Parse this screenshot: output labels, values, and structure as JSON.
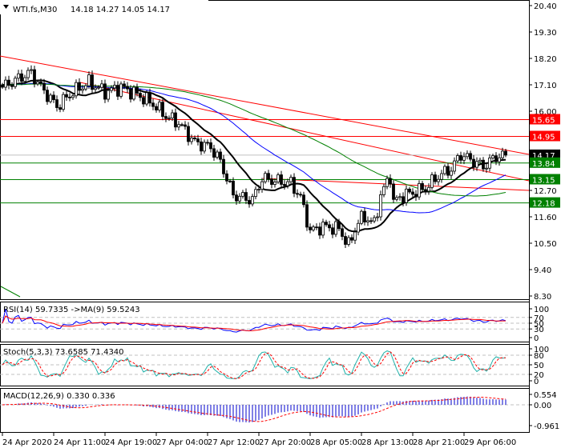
{
  "header": {
    "symbol": "WTI.fs,M30",
    "ohlc": "14.18 14.27 14.05 14.17"
  },
  "chart_data": {
    "type": "candlestick",
    "title": "WTI.fs,M30",
    "timeframe": "M30",
    "last": {
      "open": 14.18,
      "high": 14.27,
      "low": 14.05,
      "close": 14.17
    },
    "ylim": [
      8.3,
      20.4
    ],
    "price_ticks": [
      "20.40",
      "19.30",
      "18.20",
      "17.10",
      "16.00",
      "12.70",
      "11.60",
      "10.50",
      "9.40",
      "8.30"
    ],
    "x_ticks": [
      "24 Apr 2020",
      "24 Apr 11:00",
      "24 Apr 19:00",
      "27 Apr 04:00",
      "27 Apr 12:00",
      "27 Apr 20:00",
      "28 Apr 05:00",
      "28 Apr 13:00",
      "28 Apr 21:00",
      "29 Apr 06:00"
    ],
    "bars": 158,
    "close_keypoints": [
      [
        0,
        17.0
      ],
      [
        7,
        17.5
      ],
      [
        9,
        17.6
      ],
      [
        12,
        17.0
      ],
      [
        17,
        16.2
      ],
      [
        22,
        16.8
      ],
      [
        27,
        17.2
      ],
      [
        32,
        16.8
      ],
      [
        37,
        17.0
      ],
      [
        42,
        16.7
      ],
      [
        47,
        16.3
      ],
      [
        51,
        15.8
      ],
      [
        55,
        15.5
      ],
      [
        60,
        14.7
      ],
      [
        65,
        14.5
      ],
      [
        68,
        13.9
      ],
      [
        72,
        12.5
      ],
      [
        75,
        12.4
      ],
      [
        78,
        12.3
      ],
      [
        81,
        13.2
      ],
      [
        85,
        13.1
      ],
      [
        90,
        13.0
      ],
      [
        93,
        12.4
      ],
      [
        96,
        11.0
      ],
      [
        100,
        11.2
      ],
      [
        105,
        11.1
      ],
      [
        108,
        10.4
      ],
      [
        111,
        11.4
      ],
      [
        113,
        11.6
      ],
      [
        116,
        11.3
      ],
      [
        118,
        12.5
      ],
      [
        121,
        13.3
      ],
      [
        122,
        12.2
      ],
      [
        125,
        12.5
      ],
      [
        128,
        12.6
      ],
      [
        132,
        12.8
      ],
      [
        136,
        13.3
      ],
      [
        140,
        13.6
      ],
      [
        143,
        14.2
      ],
      [
        147,
        13.9
      ],
      [
        150,
        13.7
      ],
      [
        154,
        14.1
      ],
      [
        157,
        14.17
      ]
    ],
    "levels": [
      {
        "price": 15.65,
        "label": "15.65",
        "color": "#ff0000"
      },
      {
        "price": 14.95,
        "label": "14.95",
        "color": "#ff0000"
      },
      {
        "price": 14.17,
        "label": "14.17",
        "color": "#000000"
      },
      {
        "price": 13.84,
        "label": "13.84",
        "color": "#008000"
      },
      {
        "price": 13.15,
        "label": "13.15",
        "color": "#008000"
      },
      {
        "price": 12.18,
        "label": "12.18",
        "color": "#008000"
      }
    ],
    "trendlines": [
      {
        "from": [
          0,
          18.3
        ],
        "to": [
          157,
          14.2
        ],
        "color": "#ff0000"
      },
      {
        "from": [
          25,
          17.2
        ],
        "to": [
          157,
          13.1
        ],
        "color": "#ff0000"
      },
      {
        "from": [
          82,
          13.2
        ],
        "to": [
          157,
          12.7
        ],
        "color": "#ff0000"
      }
    ],
    "moving_averages": [
      {
        "period": 14,
        "color": "#000000"
      },
      {
        "period": 40,
        "color": "#0000ff"
      },
      {
        "period": 80,
        "color": "#008000"
      }
    ],
    "indicators": {
      "rsi": {
        "label": "RSI(14) 59.7335  ->MA(9) 59.5243",
        "levels": [
          "100",
          "70",
          "50",
          "30",
          "0"
        ]
      },
      "stoch": {
        "label": "Stoch(5,3,3) 73.6585 71.4340",
        "levels": [
          "100",
          "80",
          "50",
          "20",
          "0"
        ]
      },
      "macd": {
        "label": "MACD(12,26,9) 0.330 0.336",
        "levels": [
          "0.554",
          "0.00",
          "-0.961"
        ],
        "range": [
          -0.961,
          0.554
        ]
      }
    }
  }
}
